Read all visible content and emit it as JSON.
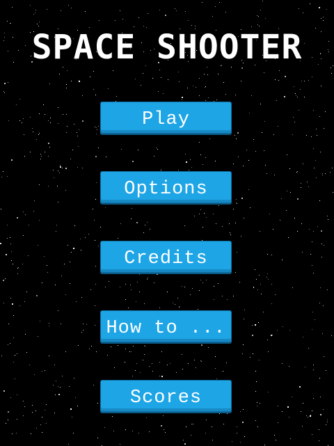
{
  "game": {
    "title": "SPACE SHOOTER"
  },
  "menu": {
    "play_label": "Play",
    "options_label": "Options",
    "credits_label": "Credits",
    "howto_label": "How to ...",
    "scores_label": "Scores"
  },
  "colors": {
    "background": "#000000",
    "button": "#1ea5e6",
    "text": "#ffffff"
  }
}
